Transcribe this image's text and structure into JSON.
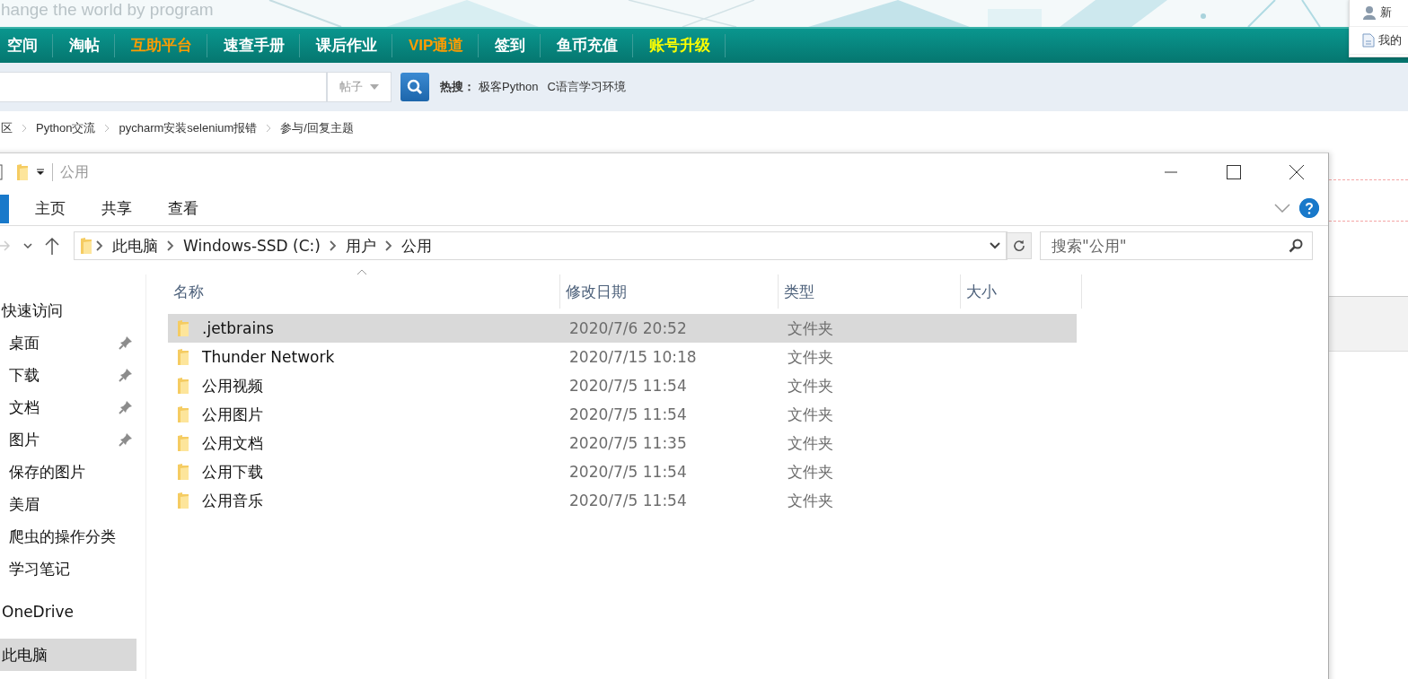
{
  "site": {
    "slogan": "hange the world by program",
    "nav": [
      {
        "label": "空间",
        "color": "#ffffff"
      },
      {
        "label": "淘帖",
        "color": "#ffffff"
      },
      {
        "label": "互助平台",
        "color": "#ff9c00"
      },
      {
        "label": "速查手册",
        "color": "#ffffff"
      },
      {
        "label": "课后作业",
        "color": "#ffffff"
      },
      {
        "label": "VIP通道",
        "color": "#ff9c00"
      },
      {
        "label": "签到",
        "color": "#ffffff"
      },
      {
        "label": "鱼币充值",
        "color": "#ffffff"
      },
      {
        "label": "账号升级",
        "color": "#ffff00"
      }
    ],
    "search": {
      "scope": "帖子",
      "hot_label": "热搜：",
      "hot_terms": [
        "极客Python",
        "C语言学习环境"
      ]
    },
    "breadcrumb": [
      "区",
      "Python交流",
      "pycharm安装selenium报错",
      "参与/回复主题"
    ],
    "popup": [
      {
        "kind": "user",
        "label": "新"
      },
      {
        "kind": "doc",
        "label": "我的"
      }
    ]
  },
  "explorer": {
    "title": "公用",
    "ribbon_tabs": [
      "主页",
      "共享",
      "查看"
    ],
    "address": [
      "此电脑",
      "Windows-SSD (C:)",
      "用户",
      "公用"
    ],
    "search": {
      "placeholder": "搜索\"公用\""
    },
    "sidebar": [
      {
        "kind": "section",
        "label": "快速访问",
        "pinned": false,
        "selected": false
      },
      {
        "kind": "item",
        "label": "桌面",
        "pinned": true,
        "selected": false
      },
      {
        "kind": "item",
        "label": "下载",
        "pinned": true,
        "selected": false
      },
      {
        "kind": "item",
        "label": "文档",
        "pinned": true,
        "selected": false
      },
      {
        "kind": "item",
        "label": "图片",
        "pinned": true,
        "selected": false
      },
      {
        "kind": "item",
        "label": "保存的图片",
        "pinned": false,
        "selected": false
      },
      {
        "kind": "item",
        "label": "美眉",
        "pinned": false,
        "selected": false
      },
      {
        "kind": "item",
        "label": "爬虫的操作分类",
        "pinned": false,
        "selected": false
      },
      {
        "kind": "item",
        "label": "学习笔记",
        "pinned": false,
        "selected": false
      },
      {
        "kind": "section",
        "label": "OneDrive",
        "pinned": false,
        "selected": false
      },
      {
        "kind": "section",
        "label": "此电脑",
        "pinned": false,
        "selected": true
      }
    ],
    "columns": [
      "名称",
      "修改日期",
      "类型",
      "大小"
    ],
    "rows": [
      {
        "name": ".jetbrains",
        "modified": "2020/7/6 20:52",
        "type": "文件夹",
        "selected": true
      },
      {
        "name": "Thunder Network",
        "modified": "2020/7/15 10:18",
        "type": "文件夹",
        "selected": false
      },
      {
        "name": "公用视频",
        "modified": "2020/7/5 11:54",
        "type": "文件夹",
        "selected": false
      },
      {
        "name": "公用图片",
        "modified": "2020/7/5 11:54",
        "type": "文件夹",
        "selected": false
      },
      {
        "name": "公用文档",
        "modified": "2020/7/5 11:35",
        "type": "文件夹",
        "selected": false
      },
      {
        "name": "公用下载",
        "modified": "2020/7/5 11:54",
        "type": "文件夹",
        "selected": false
      },
      {
        "name": "公用音乐",
        "modified": "2020/7/5 11:54",
        "type": "文件夹",
        "selected": false
      }
    ]
  }
}
